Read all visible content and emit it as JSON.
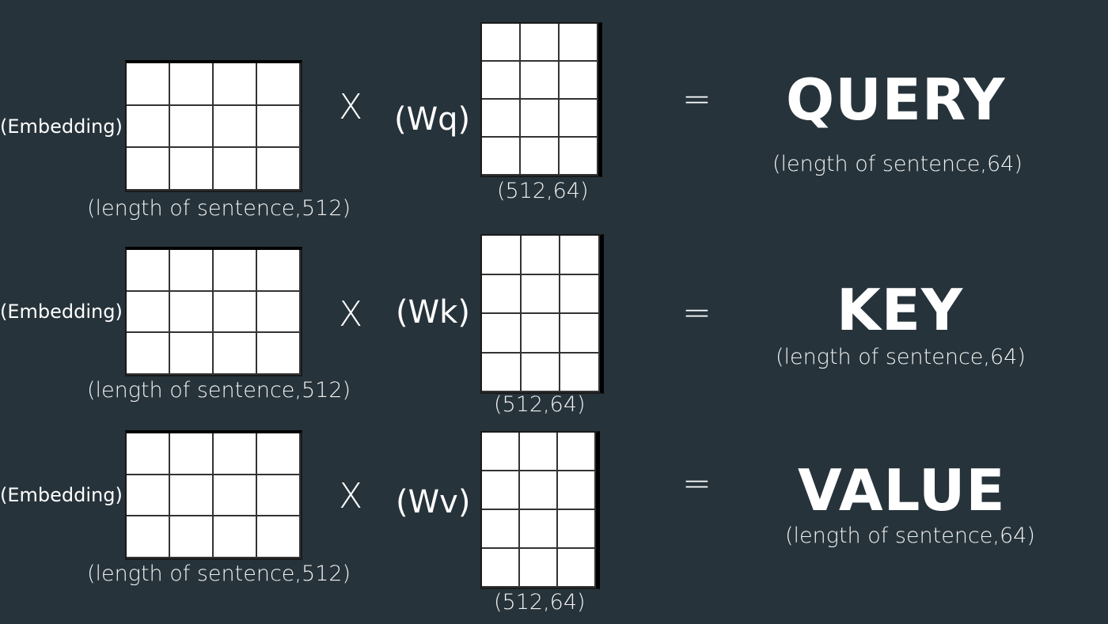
{
  "rows": [
    {
      "embedding_label": "(Embedding)",
      "embedding_dims": "(length of sentence,512)",
      "multiply_symbol": "X",
      "weight_label": "(Wq)",
      "weight_dims": "(512,64)",
      "equals_symbol": "=",
      "result_title": "QUERY",
      "result_dims": "(length of sentence,64)"
    },
    {
      "embedding_label": "(Embedding)",
      "embedding_dims": "(length of sentence,512)",
      "multiply_symbol": "X",
      "weight_label": "(Wk)",
      "weight_dims": "(512,64)",
      "equals_symbol": "=",
      "result_title": "KEY",
      "result_dims": "(length of sentence,64)"
    },
    {
      "embedding_label": "(Embedding)",
      "embedding_dims": "(length of sentence,512)",
      "multiply_symbol": "X",
      "weight_label": "(Wv)",
      "weight_dims": "(512,64)",
      "equals_symbol": "=",
      "result_title": "VALUE",
      "result_dims": "(length of sentence,64)"
    }
  ],
  "colors": {
    "background": "#26333a",
    "text": "#ffffff",
    "matrix_fill": "#ffffff",
    "grid_line": "#333333"
  }
}
